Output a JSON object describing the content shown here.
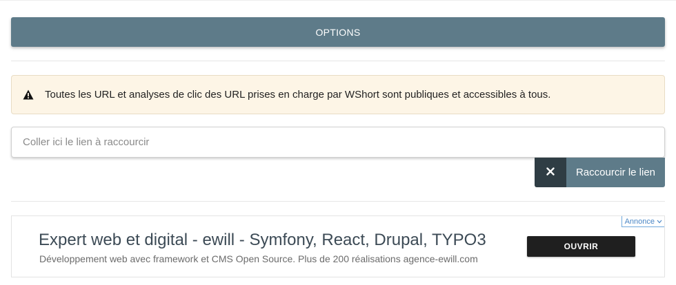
{
  "options": {
    "label": "OPTIONS"
  },
  "alert": {
    "icon": "warning-icon",
    "text": "Toutes les URL et analyses de clic des URL prises en charge par WShort sont publiques et accessibles à tous."
  },
  "url_input": {
    "placeholder": "Coller ici le lien à raccourcir",
    "value": ""
  },
  "actions": {
    "clear_icon": "close-icon",
    "shorten_label": "Raccourcir le lien"
  },
  "ad": {
    "badge_label": "Annonce",
    "title": "Expert web et digital - ewill - Symfony, React, Drupal, TYPO3",
    "description": "Développement web avec framework et CMS Open Source. Plus de 200 réalisations agence-ewill.com",
    "open_label": "OUVRIR"
  },
  "colors": {
    "primary": "#5e7b89",
    "dark": "#2f3d44",
    "alert_bg": "#fdf5e6"
  }
}
